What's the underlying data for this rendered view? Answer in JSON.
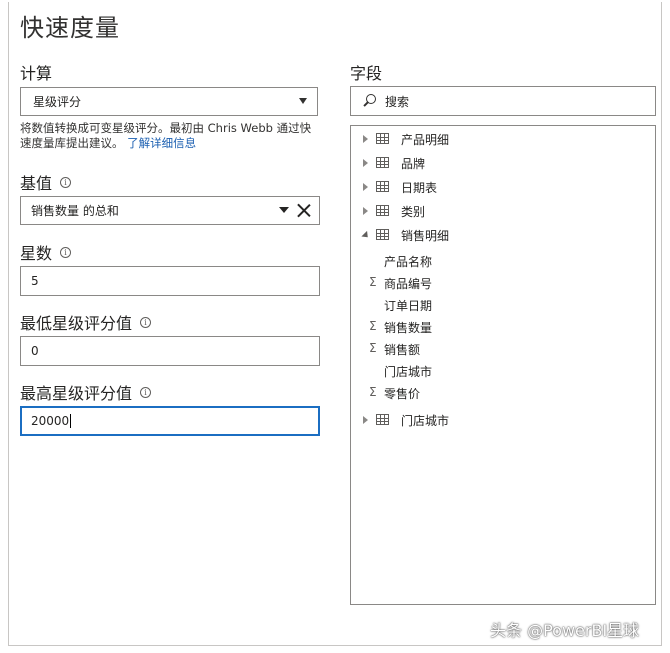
{
  "dialog": {
    "title": "快速度量"
  },
  "calculation": {
    "label": "计算",
    "selected": "星级评分",
    "description": "将数值转换成可变星级评分。最初由 Chris Webb 通过快速度量库提出建议。",
    "link": "了解详细信息"
  },
  "base_value": {
    "label": "基值",
    "value": "销售数量 的总和"
  },
  "star_count": {
    "label": "星数",
    "value": "5"
  },
  "min_rating": {
    "label": "最低星级评分值",
    "value": "0"
  },
  "max_rating": {
    "label": "最高星级评分值",
    "value": "20000"
  },
  "fields": {
    "label": "字段",
    "search_placeholder": "搜索",
    "tables": [
      {
        "name": "产品明细",
        "expanded": false
      },
      {
        "name": "品牌",
        "expanded": false
      },
      {
        "name": "日期表",
        "expanded": false
      },
      {
        "name": "类别",
        "expanded": false
      },
      {
        "name": "销售明细",
        "expanded": true
      }
    ],
    "columns": [
      {
        "name": "产品名称",
        "sigma": false
      },
      {
        "name": "商品编号",
        "sigma": true
      },
      {
        "name": "订单日期",
        "sigma": false
      },
      {
        "name": "销售数量",
        "sigma": true
      },
      {
        "name": "销售额",
        "sigma": true
      },
      {
        "name": "门店城市",
        "sigma": false
      },
      {
        "name": "零售价",
        "sigma": true
      }
    ],
    "trailing_table": {
      "name": "门店城市",
      "expanded": false
    },
    "sigma_symbol": "Σ"
  },
  "watermark": "头条 @PowerBI星球"
}
